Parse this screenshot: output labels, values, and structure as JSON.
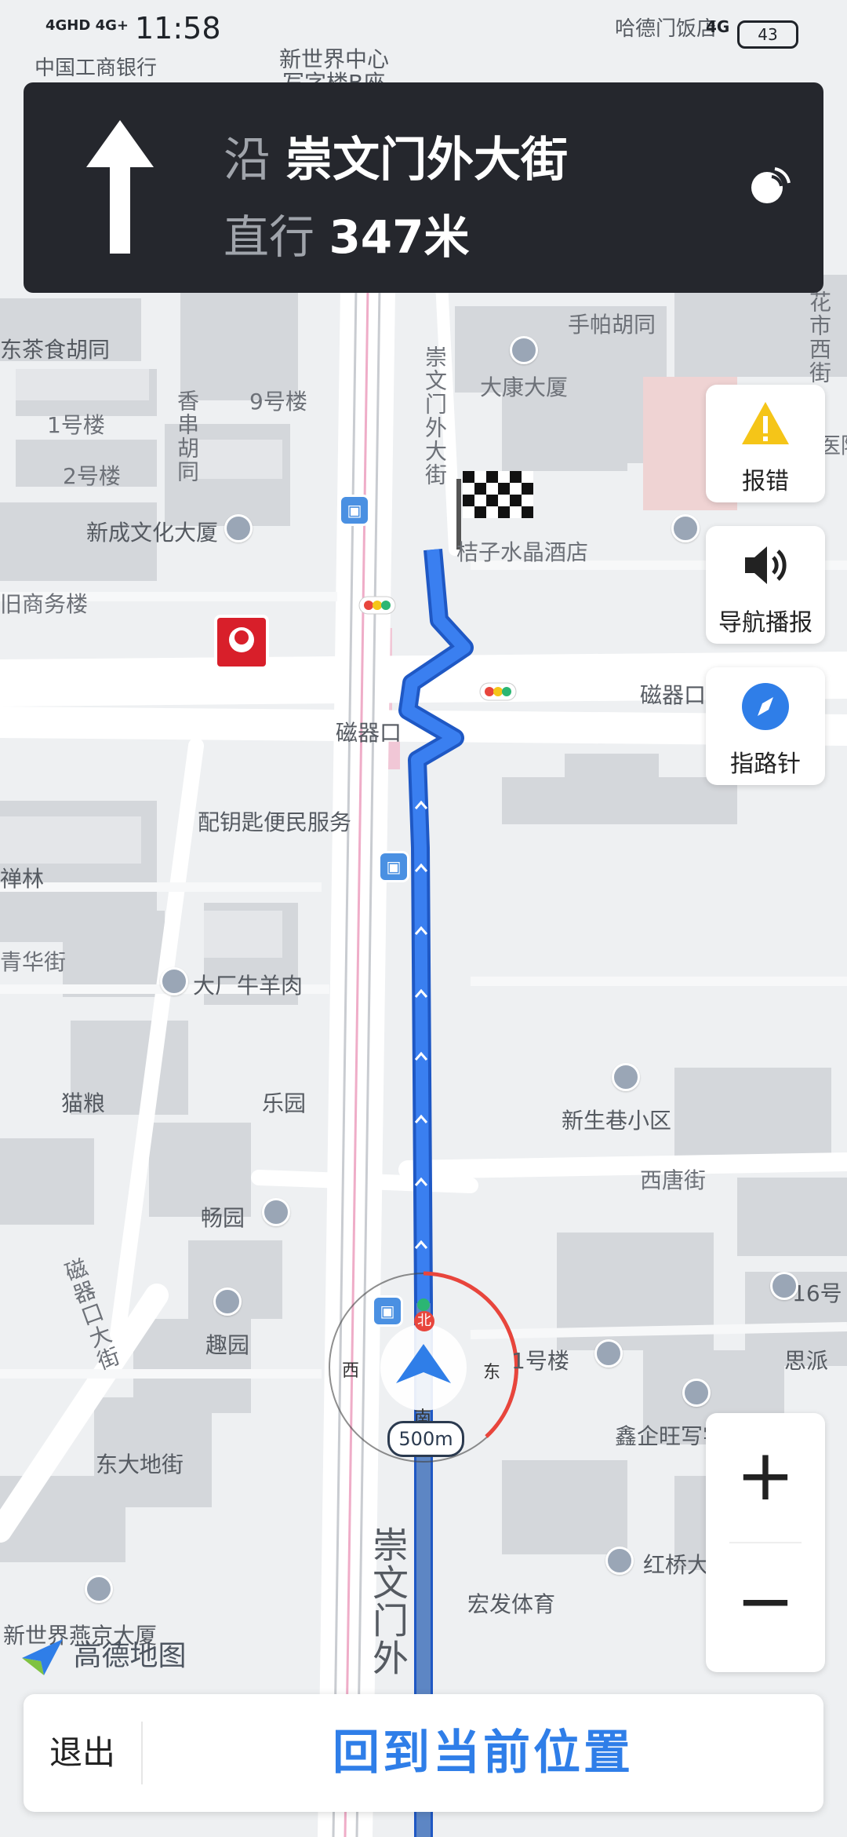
{
  "status_bar": {
    "time": "11:58",
    "signal_left": "4GHD 4G+",
    "signal_right": "4G",
    "battery": "43",
    "overlay_left": "中国工商银行",
    "overlay_right": "哈德门饭店"
  },
  "nav_panel": {
    "along_prefix": "沿",
    "road_name": "崇文门外大街",
    "action_prefix": "直行",
    "distance": "347米"
  },
  "side_buttons": {
    "report_label": "报错",
    "broadcast_label": "导航播报",
    "compass_label": "指路针"
  },
  "zoom": {
    "in_label": "+",
    "out_label": "−"
  },
  "compass": {
    "north": "北",
    "south": "南",
    "east": "东",
    "west": "西",
    "scale": "500m"
  },
  "brand": "高德地图",
  "bottom": {
    "exit_label": "退出",
    "back_label": "回到当前位置"
  },
  "map_labels": [
    "新世界中心",
    "写字楼B座",
    "手帕胡同",
    "东茶食胡同",
    "9号楼",
    "1号楼",
    "2号楼",
    "香串胡同",
    "大康大厦",
    "崇文门外大街",
    "新成文化大厦",
    "桔子水晶酒店",
    "旧商务楼",
    "磁器口",
    "磁器口",
    "配钥匙便民服务",
    "禅林",
    "青华街",
    "大厂牛羊肉",
    "猫粮",
    "乐园",
    "新生巷小区",
    "西唐街",
    "畅园",
    "趣园",
    "1号楼",
    "16号",
    "思派",
    "鑫企旺写字楼",
    "东大地街",
    "磁器口大街",
    "新世界燕京大厦",
    "红桥大剧园",
    "宏发体育",
    "崇文门外",
    "花市西街",
    "医院"
  ],
  "colors": {
    "route": "#3a7ff0",
    "panel_bg": "#25272d",
    "accent": "#2f7ee8",
    "warning": "#f5c518",
    "compass_ring": "#e8453c"
  }
}
